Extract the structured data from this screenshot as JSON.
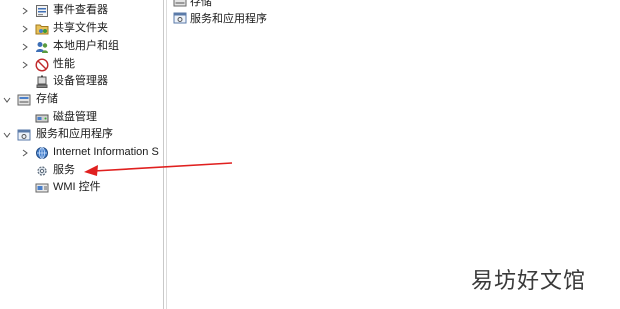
{
  "tree": {
    "items": [
      {
        "label": "事件查看器",
        "icon": "event-viewer-icon"
      },
      {
        "label": "共享文件夹",
        "icon": "shared-folders-icon"
      },
      {
        "label": "本地用户和组",
        "icon": "local-users-icon"
      },
      {
        "label": "性能",
        "icon": "performance-icon"
      },
      {
        "label": "设备管理器",
        "icon": "device-manager-icon"
      },
      {
        "label": "存储",
        "icon": "storage-icon"
      },
      {
        "label": "磁盘管理",
        "icon": "disk-management-icon"
      },
      {
        "label": "服务和应用程序",
        "icon": "services-apps-icon"
      },
      {
        "label": "Internet Information S",
        "icon": "iis-icon"
      },
      {
        "label": "服务",
        "icon": "services-gear-icon"
      },
      {
        "label": "WMI 控件",
        "icon": "wmi-control-icon"
      }
    ]
  },
  "content": {
    "items": [
      {
        "label": "存储",
        "icon": "storage-icon"
      },
      {
        "label": "服务和应用程序",
        "icon": "services-apps-icon"
      }
    ]
  },
  "annotation": {
    "color": "#e0201f"
  },
  "watermark": {
    "text": "易坊好文馆"
  }
}
